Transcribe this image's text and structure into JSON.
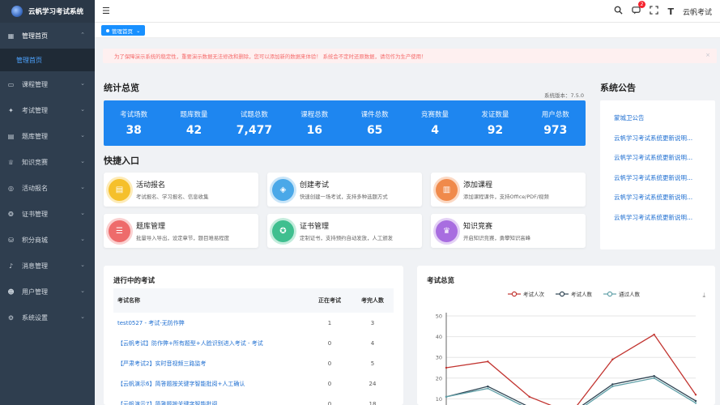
{
  "brand": {
    "title": "云帆学习考试系统"
  },
  "sidebar": {
    "items": [
      {
        "label": "管理首页",
        "icon": "grid-icon",
        "sub": [
          "管理首页"
        ]
      },
      {
        "label": "课程管理",
        "icon": "monitor-icon"
      },
      {
        "label": "考试管理",
        "icon": "settings-icon"
      },
      {
        "label": "题库管理",
        "icon": "bank-icon"
      },
      {
        "label": "知识竞赛",
        "icon": "trophy-icon"
      },
      {
        "label": "活动报名",
        "icon": "activity-icon"
      },
      {
        "label": "证书管理",
        "icon": "certificate-icon"
      },
      {
        "label": "积分商城",
        "icon": "shop-icon"
      },
      {
        "label": "消息管理",
        "icon": "bell-icon"
      },
      {
        "label": "用户管理",
        "icon": "user-icon"
      },
      {
        "label": "系统设置",
        "icon": "gear-icon"
      }
    ]
  },
  "header": {
    "badge": "2",
    "font_label": "T",
    "user": "云帆考试"
  },
  "tagbar": {
    "active_tag": "管理首页"
  },
  "alert": {
    "text": "为了保障演示系统的稳定性，重要演示数据无法修改和删除，您可以添加新的数据来体验！ 系统会不定时还原数据，请勿作为生产使用！",
    "close": "×"
  },
  "stats": {
    "title": "统计总览",
    "version": "系统版本：7.5.0",
    "items": [
      {
        "label": "考试场数",
        "value": "38"
      },
      {
        "label": "题库数量",
        "value": "42"
      },
      {
        "label": "试题总数",
        "value": "7,477"
      },
      {
        "label": "课程总数",
        "value": "16"
      },
      {
        "label": "课件总数",
        "value": "65"
      },
      {
        "label": "竞赛数量",
        "value": "4"
      },
      {
        "label": "发证数量",
        "value": "92"
      },
      {
        "label": "用户总数",
        "value": "973"
      }
    ]
  },
  "quick": {
    "title": "快捷入口",
    "items": [
      {
        "title": "活动报名",
        "desc": "考试报名、学习报名、信息收集",
        "color": "#f5c02b"
      },
      {
        "title": "创建考试",
        "desc": "快速创建一场考试，支持多种选题方式",
        "color": "#4aa8e8"
      },
      {
        "title": "添加课程",
        "desc": "添加课程课件，支持Office/PDF/视频",
        "color": "#f08a4b"
      },
      {
        "title": "题库管理",
        "desc": "批量导入导出，设定章节，题目难易程度",
        "color": "#ee6b6b"
      },
      {
        "title": "证书管理",
        "desc": "定制证书，支持预约自动发放，人工颁发",
        "color": "#3fbf8f"
      },
      {
        "title": "知识竞赛",
        "desc": "开启知识竞赛，勇攀知识高峰",
        "color": "#a86de0"
      }
    ]
  },
  "notices": {
    "title": "系统公告",
    "items": [
      "蒙城卫公告",
      "云帆学习考试系统更新说明...",
      "云帆学习考试系统更新说明...",
      "云帆学习考试系统更新说明...",
      "云帆学习考试系统更新说明...",
      "云帆学习考试系统更新说明..."
    ]
  },
  "exams": {
    "title": "进行中的考试",
    "headers": [
      "考试名称",
      "正在考试",
      "考完人数"
    ],
    "rows": [
      [
        "test0527 - 考试-无防作弊",
        "1",
        "3"
      ],
      [
        "【云帆考试】防作弊+所有题型+人脸识别进入考试 - 考试",
        "0",
        "4"
      ],
      [
        "【严肃考试2】实时音视频三路监考",
        "0",
        "5"
      ],
      [
        "【云帆演示6】简答题按关键字智能批阅+人工确认",
        "0",
        "24"
      ],
      [
        "【云帆演示7】简答题按关键字智能批阅",
        "0",
        "18"
      ]
    ]
  },
  "chart_data": {
    "type": "line",
    "title": "考试总览",
    "legend_position": "top",
    "ylim": [
      0,
      50
    ],
    "yticks": [
      "50",
      "40",
      "30",
      "20",
      "10"
    ],
    "series": [
      {
        "name": "考试人次",
        "color": "#c23531",
        "values": [
          25,
          28,
          11,
          3,
          29,
          41,
          12
        ]
      },
      {
        "name": "考试人数",
        "color": "#2f4554",
        "values": [
          11,
          16,
          6,
          3,
          17,
          21,
          9
        ]
      },
      {
        "name": "通过人数",
        "color": "#61a0a8",
        "values": [
          11,
          15,
          5,
          2,
          16,
          20,
          8
        ]
      }
    ]
  }
}
